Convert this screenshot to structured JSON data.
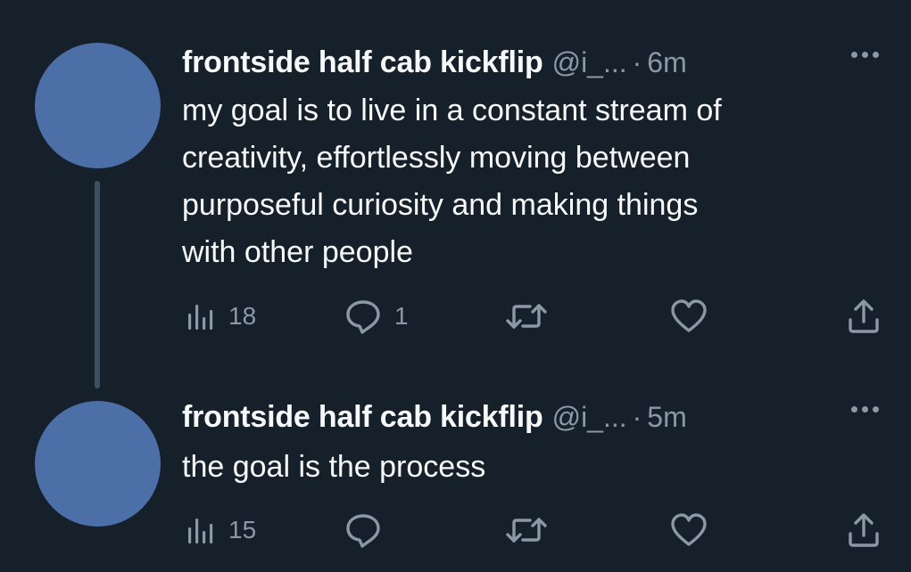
{
  "tweets": [
    {
      "display_name": "frontside half cab kickflip",
      "handle": "@i_...",
      "separator": "·",
      "time": "6m",
      "text_lines": [
        "my goal is to live in a constant stream of",
        "creativity, effortlessly moving between",
        "purposeful curiosity and making things",
        "with other people"
      ],
      "views": "18",
      "replies": "1",
      "retweets": "",
      "likes": ""
    },
    {
      "display_name": "frontside half cab kickflip",
      "handle": "@i_...",
      "separator": "·",
      "time": "5m",
      "text_lines": [
        "the goal is the process"
      ],
      "views": "15",
      "replies": "",
      "retweets": "",
      "likes": ""
    }
  ],
  "colors": {
    "background": "#15202b",
    "avatar": "#4c6fa8",
    "thread_line": "#3e4f5f",
    "primary_text": "#f7f9f9",
    "secondary_text": "#8b98a5"
  },
  "icons": {
    "views": "bar-chart-icon",
    "reply": "speech-bubble-icon",
    "retweet": "retweet-icon",
    "like": "heart-icon",
    "share": "share-icon",
    "more": "more-dots-icon"
  }
}
